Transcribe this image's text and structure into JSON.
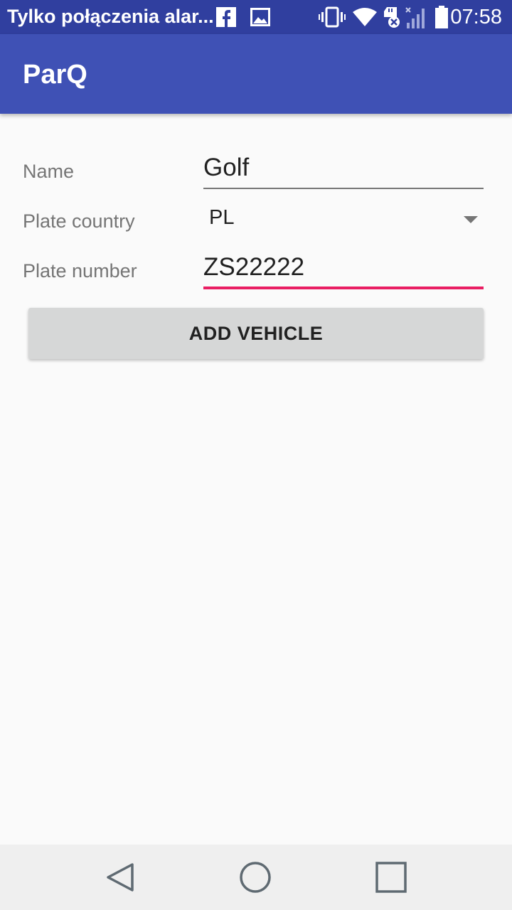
{
  "status_bar": {
    "notification_text": "Tylko połączenia alar...",
    "time": "07:58",
    "icons": [
      "facebook-icon",
      "image-icon",
      "vibrate-icon",
      "wifi-icon",
      "sd-card-error-icon",
      "signal-off-icon",
      "battery-icon"
    ]
  },
  "app_bar": {
    "title": "ParQ",
    "color": "#3f51b5"
  },
  "form": {
    "name_label": "Name",
    "name_value": "Golf",
    "country_label": "Plate country",
    "country_value": "PL",
    "plate_label": "Plate number",
    "plate_value": "ZS22222",
    "accent_color": "#e91e63"
  },
  "add_button_label": "ADD VEHICLE",
  "nav_bar": {
    "icons": [
      "back-icon",
      "home-icon",
      "recents-icon"
    ]
  }
}
